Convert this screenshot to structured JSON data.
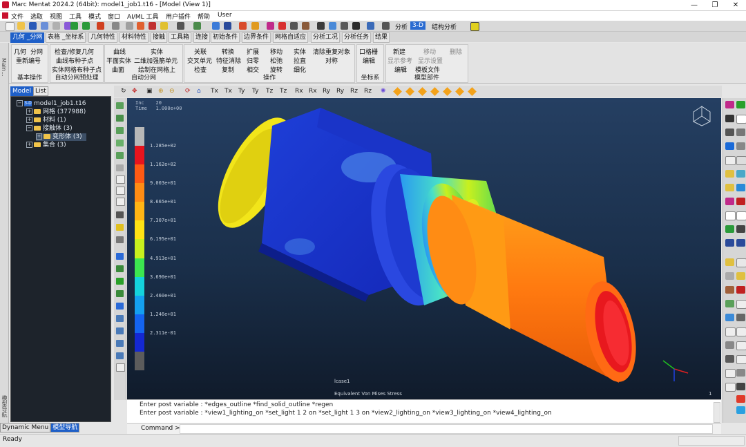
{
  "window": {
    "title": "Marc Mentat 2024.2 (64bit): model1_job1.t16 - [Model (View 1)]",
    "controls": [
      "—",
      "❐",
      "✕"
    ]
  },
  "menubar": {
    "items": [
      "文件",
      "选取",
      "视图",
      "工具",
      "模式",
      "窗口",
      "AI/ML 工具",
      "用户插件",
      "帮助",
      "User"
    ],
    "doc_controls": [
      "_",
      "❐",
      "✕"
    ]
  },
  "toolbar": {
    "analysis_label": "分析",
    "dimension": "3-D",
    "structural_label": "结构分析"
  },
  "tabs": [
    "几何 _分网",
    "表格 _坐标系",
    "几何特性",
    "材料特性",
    "接触",
    "工具箱",
    "连接",
    "初始条件",
    "边界条件",
    "网格自适应",
    "分析工况",
    "分析任务",
    "结果"
  ],
  "ribbon": {
    "groups": [
      {
        "title": "基本操作",
        "items": [
          "几何",
          "分网",
          "重新编号"
        ]
      },
      {
        "title": "自动分网预处理",
        "items": [
          "检查/修复几何",
          "曲线布种子点",
          "实体网格布种子点"
        ]
      },
      {
        "title": "自动分网",
        "items": [
          "曲线",
          "实体",
          "平面实体",
          "二维加强筋单元",
          "曲面",
          "绘制在网格上"
        ]
      },
      {
        "title": "操作",
        "items": [
          "关联",
          "转换",
          "扩展",
          "移动",
          "实体",
          "清除重复对象",
          "交叉单元",
          "特征消除",
          "归零",
          "松弛",
          "拉直",
          "对称",
          "检查",
          "复制",
          "相交",
          "旋转",
          "细化"
        ]
      },
      {
        "title": "坐标系",
        "items": [
          "口格栅",
          "编辑"
        ]
      },
      {
        "title": "模型部件",
        "items": [
          "新建",
          "移动",
          "删除",
          "显示参考",
          "显示设置",
          "编辑",
          "模板文件"
        ]
      }
    ]
  },
  "sidebar": {
    "tabs": [
      "Model",
      "List"
    ],
    "side_label": "Main...",
    "nav_label": "模型导航",
    "tree": [
      {
        "label": "model1_job1.t16",
        "icon": "3-D",
        "level": 0
      },
      {
        "label": "网格 (377988)",
        "level": 1
      },
      {
        "label": "材料 (1)",
        "level": 1
      },
      {
        "label": "接触体 (3)",
        "level": 1
      },
      {
        "label": "变形体 (3)",
        "level": 2
      },
      {
        "label": "集合 (3)",
        "level": 1
      }
    ],
    "bottom_tabs": [
      "Dynamic Menu",
      "模型导航"
    ]
  },
  "viewport": {
    "inc_label": "Inc    20",
    "time_label": "Time   1.000e+00",
    "legend_values": [
      "1.285e+02",
      "1.162e+02",
      "9.003e+01",
      "8.665e+01",
      "7.307e+01",
      "6.195e+01",
      "4.913e+01",
      "3.690e+01",
      "2.460e+01",
      "1.246e+01",
      "2.311e-01"
    ],
    "legend_colors": [
      "#b8b8b8",
      "#e8141e",
      "#ff5a14",
      "#ff8c14",
      "#ffb414",
      "#ffe214",
      "#c8f01e",
      "#3ce650",
      "#14d2dc",
      "#14a0f0",
      "#1464f0",
      "#1428d2",
      "#5c5c5c"
    ],
    "frame_label": "lcase1",
    "result_label": "Equivalent Von Mises Stress",
    "corner_label": "1"
  },
  "console": {
    "lines": [
      "Enter post variable : *edges_outline *find_solid_outline *regen",
      "Enter post variable : *view1_lighting_on *set_light 1 2 on *set_light 1 3 on *view2_lighting_on *view3_lighting_on *view4_lighting_on"
    ],
    "command_label": "Command >"
  },
  "status": {
    "text": "Ready"
  }
}
